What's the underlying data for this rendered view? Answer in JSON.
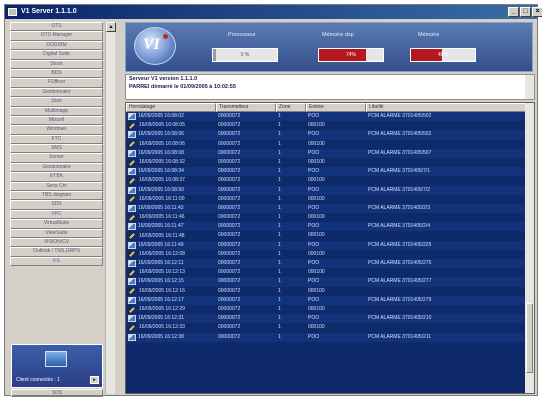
{
  "window": {
    "title": "V1 Server 1.1.1.0"
  },
  "titlebar_buttons": [
    "_",
    "□",
    "×"
  ],
  "sidebar": {
    "items": [
      "OTS",
      "OTS Manager",
      "DODDIM",
      "Digital Suite",
      "Stock",
      "BDS",
      "FOfficer",
      "Gestionnaire",
      "Start",
      "Multimapp",
      "Miscell",
      "Windows",
      "FTC",
      "SMS",
      "Server",
      "Gestionnaire",
      "ETBK",
      "Sens Ctrl",
      "TBS diagram",
      "SDS",
      "VPC",
      "VirtualSuite",
      "ViewSuite",
      "VISION/CV",
      "Outlook / TNS,GRPS",
      "FS"
    ],
    "panel_label": "Client connectés : 1",
    "panel_button": "▸",
    "bottom_item": "SDS"
  },
  "header": {
    "logo_text": "VI",
    "gauges": [
      {
        "title": "Processeur",
        "value_text": "0 %",
        "level": 0.05,
        "color": "#9a9a9a"
      },
      {
        "title": "Mémoire dsp",
        "value_text": "74%",
        "level": 0.74,
        "color": "#b5181f"
      },
      {
        "title": "Mémoire",
        "value_text": "48%",
        "level": 0.48,
        "color": "#b5181f"
      }
    ]
  },
  "info": {
    "line1": "Serveur V1 version 1.1.1.0",
    "line2": "PARREI démarré le 01/09/2005 à 10:02:55"
  },
  "table": {
    "columns": [
      "Horodatage",
      "Transmetteur",
      "Zone",
      "Entrée",
      "Libellé"
    ],
    "rows": [
      {
        "icon": "a",
        "date": "16/09/2005 16:08:02",
        "tx": "00000072",
        "zone": "1",
        "entry": "POO",
        "label": "PCM ALARME 3701405/502"
      },
      {
        "icon": "b",
        "date": "16/09/2005 16:08:05",
        "tx": "00000072",
        "zone": "1",
        "entry": "000100",
        "label": ""
      },
      {
        "icon": "a",
        "date": "16/09/2005 16:08:06",
        "tx": "00000072",
        "zone": "1",
        "entry": "POO",
        "label": "PCM ALARME 3701405/502"
      },
      {
        "icon": "b",
        "date": "16/09/2005 16:08:06",
        "tx": "00000072",
        "zone": "1",
        "entry": "000100",
        "label": ""
      },
      {
        "icon": "a",
        "date": "16/09/2005 16:08:08",
        "tx": "00000072",
        "zone": "1",
        "entry": "POO",
        "label": "PCM ALARME 3701405/507"
      },
      {
        "icon": "b",
        "date": "16/09/2005 16:08:32",
        "tx": "00000072",
        "zone": "1",
        "entry": "000100",
        "label": ""
      },
      {
        "icon": "a",
        "date": "16/09/2005 16:08:34",
        "tx": "00000072",
        "zone": "1",
        "entry": "POO",
        "label": "PCM ALARME 3701405/7/1"
      },
      {
        "icon": "b",
        "date": "16/09/2005 16:08:37",
        "tx": "00000072",
        "zone": "1",
        "entry": "000100",
        "label": ""
      },
      {
        "icon": "a",
        "date": "16/09/2005 16:08:50",
        "tx": "00000072",
        "zone": "1",
        "entry": "POO",
        "label": "PCM ALARME 3701405/7/2"
      },
      {
        "icon": "b",
        "date": "16/09/2005 16:11:00",
        "tx": "00000072",
        "zone": "1",
        "entry": "000100",
        "label": ""
      },
      {
        "icon": "a",
        "date": "16/09/2005 16:11:43",
        "tx": "00000072",
        "zone": "1",
        "entry": "POO",
        "label": "PCM ALARME 3701405/2/3"
      },
      {
        "icon": "b",
        "date": "16/09/2005 16:11:46",
        "tx": "00000072",
        "zone": "1",
        "entry": "000100",
        "label": ""
      },
      {
        "icon": "a",
        "date": "16/09/2005 16:11:47",
        "tx": "00000072",
        "zone": "1",
        "entry": "POO",
        "label": "PCM ALARME 3701405/2/4"
      },
      {
        "icon": "b",
        "date": "16/09/2005 16:11:48",
        "tx": "00000072",
        "zone": "1",
        "entry": "000100",
        "label": ""
      },
      {
        "icon": "a",
        "date": "16/09/2005 16:11:49",
        "tx": "00000072",
        "zone": "1",
        "entry": "POO",
        "label": "PCM ALARME 3701405/225"
      },
      {
        "icon": "b",
        "date": "16/09/2005 16:12:08",
        "tx": "00000072",
        "zone": "1",
        "entry": "000100",
        "label": ""
      },
      {
        "icon": "a",
        "date": "16/09/2005 16:12:11",
        "tx": "00000072",
        "zone": "1",
        "entry": "POO",
        "label": "PCM ALARME 3701405/276"
      },
      {
        "icon": "b",
        "date": "16/09/2005 16:12:13",
        "tx": "00000072",
        "zone": "1",
        "entry": "000100",
        "label": ""
      },
      {
        "icon": "a",
        "date": "16/09/2005 16:12:15",
        "tx": "00000072",
        "zone": "1",
        "entry": "POO",
        "label": "PCM ALARME 3701405/277"
      },
      {
        "icon": "b",
        "date": "16/09/2005 16:12:16",
        "tx": "00000072",
        "zone": "1",
        "entry": "000100",
        "label": ""
      },
      {
        "icon": "a",
        "date": "16/09/2005 16:12:17",
        "tx": "00000072",
        "zone": "1",
        "entry": "POO",
        "label": "PCM ALARME 3701405/279"
      },
      {
        "icon": "b",
        "date": "16/09/2005 16:12:29",
        "tx": "00000072",
        "zone": "1",
        "entry": "000100",
        "label": ""
      },
      {
        "icon": "a",
        "date": "16/09/2005 16:12:31",
        "tx": "00000072",
        "zone": "1",
        "entry": "POO",
        "label": "PCM ALARME 3701405/210"
      },
      {
        "icon": "b",
        "date": "16/09/2005 16:12:33",
        "tx": "00000072",
        "zone": "1",
        "entry": "000100",
        "label": ""
      },
      {
        "icon": "a",
        "date": "16/09/2005 16:12:38",
        "tx": "00000072",
        "zone": "1",
        "entry": "POO",
        "label": "PCM ALARME 3701405/211"
      }
    ]
  }
}
